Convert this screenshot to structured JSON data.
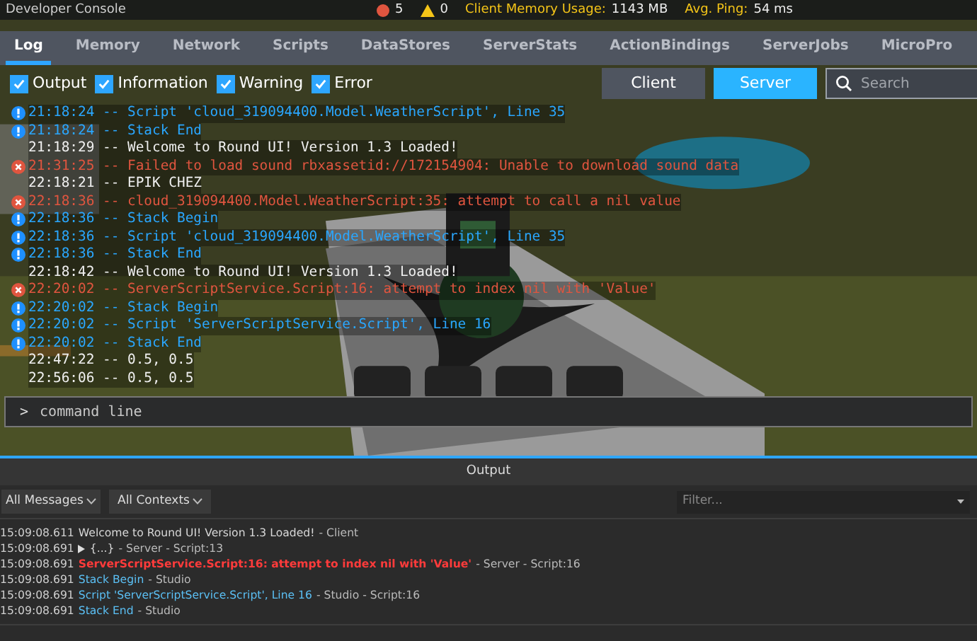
{
  "top_bar": {
    "title": "Developer Console",
    "error_count": "5",
    "warning_count": "0",
    "memory_label": "Client Memory Usage:",
    "memory_value": "1143 MB",
    "ping_label": "Avg. Ping:",
    "ping_value": "54 ms"
  },
  "tabs": [
    {
      "label": "Log",
      "selected": true
    },
    {
      "label": "Memory",
      "selected": false
    },
    {
      "label": "Network",
      "selected": false
    },
    {
      "label": "Scripts",
      "selected": false
    },
    {
      "label": "DataStores",
      "selected": false
    },
    {
      "label": "ServerStats",
      "selected": false
    },
    {
      "label": "ActionBindings",
      "selected": false
    },
    {
      "label": "ServerJobs",
      "selected": false
    },
    {
      "label": "MicroPro",
      "selected": false
    }
  ],
  "filters": [
    {
      "label": "Output",
      "checked": true
    },
    {
      "label": "Information",
      "checked": true
    },
    {
      "label": "Warning",
      "checked": true
    },
    {
      "label": "Error",
      "checked": true
    }
  ],
  "scope": [
    {
      "label": "Client",
      "selected": false
    },
    {
      "label": "Server",
      "selected": true
    }
  ],
  "search": {
    "placeholder": "Search"
  },
  "log": [
    {
      "kind": "info",
      "text": "21:18:24 -- Script 'cloud_319094400.Model.WeatherScript', Line 35"
    },
    {
      "kind": "info",
      "text": "21:18:24 -- Stack End"
    },
    {
      "kind": "output",
      "text": "21:18:29 -- Welcome to Round UI! Version 1.3 Loaded!"
    },
    {
      "kind": "error",
      "text": "21:31:25 -- Failed to load sound rbxassetid://172154904: Unable to download sound data"
    },
    {
      "kind": "output",
      "text": "22:18:21 -- EPIK CHEZ"
    },
    {
      "kind": "error",
      "text": "22:18:36 -- cloud_319094400.Model.WeatherScript:35: attempt to call a nil value"
    },
    {
      "kind": "info",
      "text": "22:18:36 -- Stack Begin"
    },
    {
      "kind": "info",
      "text": "22:18:36 -- Script 'cloud_319094400.Model.WeatherScript', Line 35"
    },
    {
      "kind": "info",
      "text": "22:18:36 -- Stack End"
    },
    {
      "kind": "output",
      "text": "22:18:42 -- Welcome to Round UI! Version 1.3 Loaded!"
    },
    {
      "kind": "error",
      "text": "22:20:02 -- ServerScriptService.Script:16: attempt to index nil with 'Value'"
    },
    {
      "kind": "info",
      "text": "22:20:02 -- Stack Begin"
    },
    {
      "kind": "info",
      "text": "22:20:02 -- Script 'ServerScriptService.Script', Line 16"
    },
    {
      "kind": "info",
      "text": "22:20:02 -- Stack End"
    },
    {
      "kind": "output",
      "text": "22:47:22 -- 0.5, 0.5"
    },
    {
      "kind": "output",
      "text": "22:56:06 -- 0.5, 0.5"
    }
  ],
  "command_line": {
    "prompt": ">",
    "placeholder": "command line"
  },
  "output_panel": {
    "title": "Output",
    "message_filter": "All Messages",
    "context_filter": "All Contexts",
    "filter": {
      "placeholder": "Filter..."
    },
    "rows": [
      {
        "kind": "output",
        "time": "15:09:08.611",
        "message": "Welcome to Round UI! Version 1.3 Loaded!",
        "source": "- Client"
      },
      {
        "kind": "table",
        "time": "15:09:08.691",
        "message": "{...}",
        "source": "- Server - Script:13"
      },
      {
        "kind": "error",
        "time": "15:09:08.691",
        "message": "ServerScriptService.Script:16: attempt to index nil with 'Value'",
        "source": "- Server - Script:16"
      },
      {
        "kind": "info",
        "time": "15:09:08.691",
        "message": "Stack Begin",
        "source": "- Studio"
      },
      {
        "kind": "info",
        "time": "15:09:08.691",
        "message": "Script 'ServerScriptService.Script', Line 16",
        "source": "- Studio - Script:16"
      },
      {
        "kind": "info",
        "time": "15:09:08.691",
        "message": "Stack End",
        "source": "- Studio"
      }
    ]
  }
}
